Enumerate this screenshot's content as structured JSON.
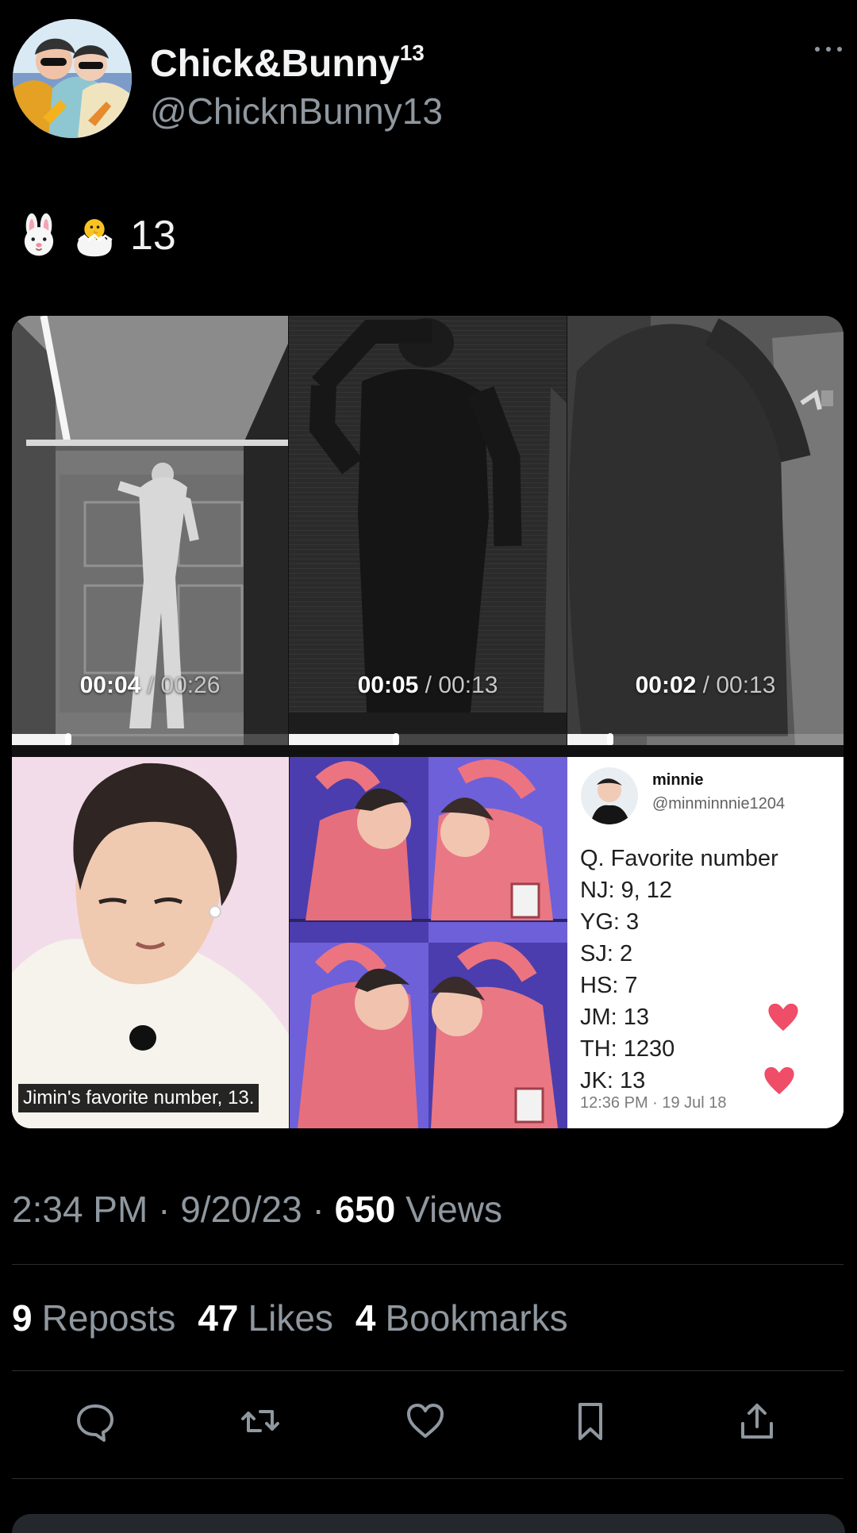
{
  "profile": {
    "display_name": "Chick&Bunny",
    "display_name_sup": "13",
    "handle": "@ChicknBunny13"
  },
  "tweet": {
    "emojis": [
      "rabbit-face-emoji",
      "hatching-chick-emoji"
    ],
    "number": "13"
  },
  "videos": [
    {
      "current": "00:04",
      "separator": "/",
      "total": "00:26",
      "progress": 0.205
    },
    {
      "current": "00:05",
      "separator": "/",
      "total": "00:13",
      "progress": 0.385
    },
    {
      "current": "00:02",
      "separator": "/",
      "total": "00:13",
      "progress": 0.154
    }
  ],
  "photos": {
    "caption": "Jimin's favorite number, 13.",
    "card": {
      "name": "minnie",
      "handle": "@minminnnie1204",
      "lines": [
        "Q. Favorite number",
        "NJ: 9, 12",
        "YG: 3",
        "SJ: 2",
        "HS: 7",
        "JM: 13",
        "TH: 1230",
        "JK: 13"
      ],
      "timestamp": "12:36 PM · 19 Jul 18"
    }
  },
  "meta": {
    "time": "2:34 PM",
    "separator1": "·",
    "date": "9/20/23",
    "separator2": "·",
    "views_count": "650",
    "views_label": "Views"
  },
  "stats": {
    "reposts_count": "9",
    "reposts_label": "Reposts",
    "likes_count": "47",
    "likes_label": "Likes",
    "bookmarks_count": "4",
    "bookmarks_label": "Bookmarks"
  },
  "icons": {
    "more": "ellipsis-icon",
    "reply": "reply-icon",
    "repost": "repost-icon",
    "like": "heart-icon",
    "bookmark": "bookmark-icon",
    "share": "share-icon"
  },
  "colors": {
    "background": "#000000",
    "text_primary": "#ffffff",
    "text_secondary": "#8f979f",
    "divider": "#2b2f33",
    "heart": "#ef4d68"
  }
}
